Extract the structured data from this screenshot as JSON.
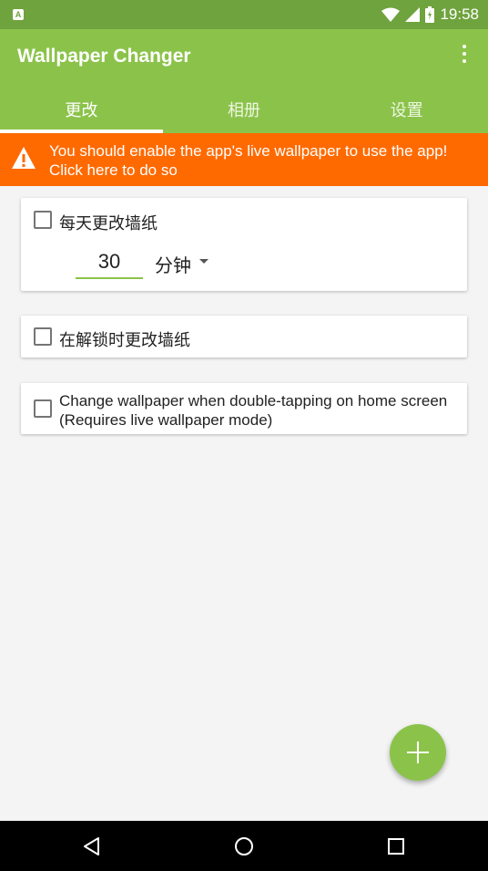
{
  "status_bar": {
    "notification_icon": "A",
    "time": "19:58"
  },
  "app_bar": {
    "title": "Wallpaper Changer",
    "menu_icon": "more-vert-icon"
  },
  "tabs": [
    {
      "label": "更改",
      "active": true
    },
    {
      "label": "相册",
      "active": false
    },
    {
      "label": "设置",
      "active": false
    }
  ],
  "banner": {
    "line1": "You should enable the app's live wallpaper to use the app!",
    "line2": "Click here to do so",
    "icon": "warning-icon",
    "color": "#ff6a00"
  },
  "cards": {
    "daily": {
      "label": "每天更改墙纸",
      "checked": false,
      "interval_value": "30",
      "interval_unit": "分钟"
    },
    "unlock": {
      "label": "在解锁时更改墙纸",
      "checked": false
    },
    "double_tap": {
      "line1": "Change wallpaper when double-tapping on home screen",
      "line2": "(Requires live wallpaper mode)",
      "checked": false
    }
  },
  "fab": {
    "icon": "plus-icon"
  },
  "colors": {
    "primary": "#8bc34a",
    "primary_dark": "#6fa33e",
    "background": "#f4f4f4"
  }
}
